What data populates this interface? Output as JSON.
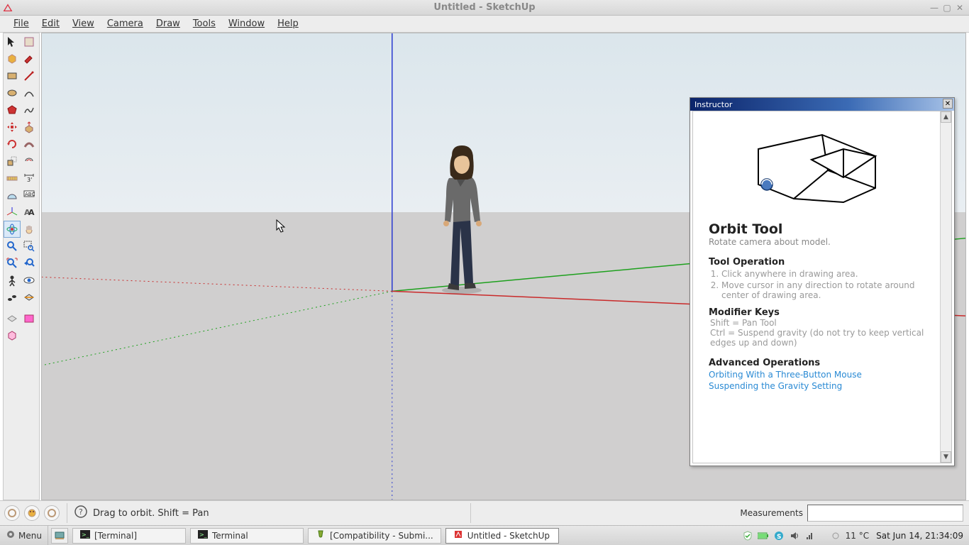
{
  "window": {
    "title": "Untitled - SketchUp"
  },
  "menubar": {
    "items": [
      "File",
      "Edit",
      "View",
      "Camera",
      "Draw",
      "Tools",
      "Window",
      "Help"
    ]
  },
  "statusbar": {
    "hint": "Drag to orbit.  Shift = Pan",
    "measurements_label": "Measurements"
  },
  "instructor": {
    "header": "Instructor",
    "title": "Orbit Tool",
    "subtitle": "Rotate camera about model.",
    "operation_header": "Tool Operation",
    "operations": [
      "Click anywhere in drawing area.",
      "Move cursor in any direction to rotate around center of drawing area."
    ],
    "modifier_header": "Modifier Keys",
    "modifiers": [
      "Shift = Pan Tool",
      "Ctrl = Suspend gravity (do not try to keep vertical edges up and down)"
    ],
    "advanced_header": "Advanced Operations",
    "advanced_links": [
      "Orbiting With a Three-Button Mouse",
      "Suspending the Gravity Setting"
    ]
  },
  "taskbar": {
    "start": "Menu",
    "tasks": [
      {
        "label": "[Terminal]"
      },
      {
        "label": "Terminal"
      },
      {
        "label": "[Compatibility - Submi..."
      },
      {
        "label": "Untitled - SketchUp"
      }
    ],
    "temperature": "11 °C",
    "clock": "Sat Jun 14, 21:34:09"
  },
  "tools": {
    "rows": [
      [
        "select",
        "template"
      ],
      [
        "component",
        "paint"
      ],
      [
        "rectangle",
        "line"
      ],
      [
        "circle",
        "arc"
      ],
      [
        "polygon",
        "freehand"
      ],
      [
        "move",
        "rotate"
      ],
      [
        "pushpull",
        "followme"
      ],
      [
        "scale",
        "offset"
      ],
      [
        "tape",
        "dimension"
      ],
      [
        "protractor",
        "text"
      ],
      [
        "axes",
        "3dtext"
      ],
      [
        "orbit",
        "pan"
      ],
      [
        "zoom",
        "zoomwindow"
      ],
      [
        "zoomextents",
        "previous"
      ],
      [
        "position",
        "lookaround"
      ],
      [
        "walk",
        "section"
      ]
    ],
    "extra": [
      [
        "ext1",
        "ext2"
      ],
      [
        "ext3",
        ""
      ]
    ],
    "selected": "orbit"
  }
}
